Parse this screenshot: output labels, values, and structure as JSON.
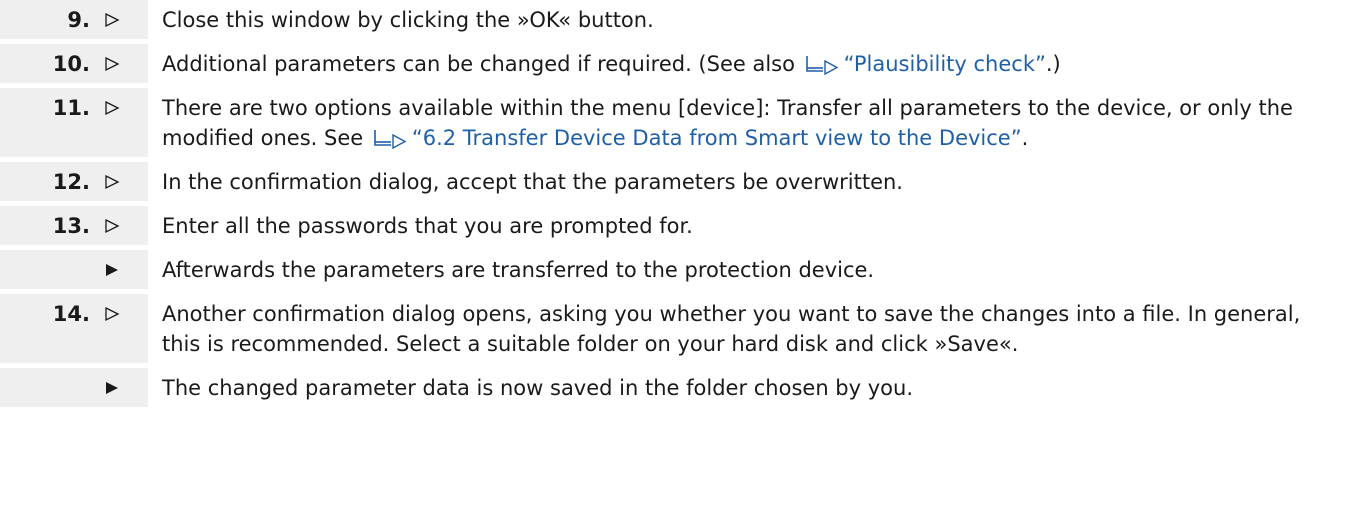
{
  "steps": [
    {
      "number": "9.",
      "marker": "triangle-outline-icon",
      "text_before": "Close this window by clicking the »OK« button."
    },
    {
      "number": "10.",
      "marker": "triangle-outline-icon",
      "text_before": "Additional parameters can be changed if required. (See also ",
      "link_text": "“Plausibility check”",
      "text_after": ".)"
    },
    {
      "number": "11.",
      "marker": "triangle-outline-icon",
      "text_before": "There are two options available within the menu [device]: Transfer all parameters to the device, or only the modified ones. See ",
      "link_text": "“6.2 Transfer Device Data from Smart view to the Device”",
      "text_after": "."
    },
    {
      "number": "12.",
      "marker": "triangle-outline-icon",
      "text_before": "In the confirmation dialog, accept that the parameters be overwritten."
    },
    {
      "number": "13.",
      "marker": "triangle-outline-icon",
      "text_before": "Enter all the passwords that you are prompted for."
    },
    {
      "number": "",
      "marker": "triangle-filled-icon",
      "text_before": "Afterwards the parameters are transferred to the protection device."
    },
    {
      "number": "14.",
      "marker": "triangle-outline-icon",
      "text_before": "Another confirmation dialog opens, asking you whether you want to save the changes into a file. In general, this is recommended. Select a suitable folder on your hard disk and click »Save«."
    },
    {
      "number": "",
      "marker": "triangle-filled-icon",
      "text_before": "The changed parameter data is now saved in the folder chosen by you."
    }
  ],
  "colors": {
    "gutter_background": "#efefef",
    "link": "#1f5fa8",
    "text": "#1a1a1a"
  }
}
